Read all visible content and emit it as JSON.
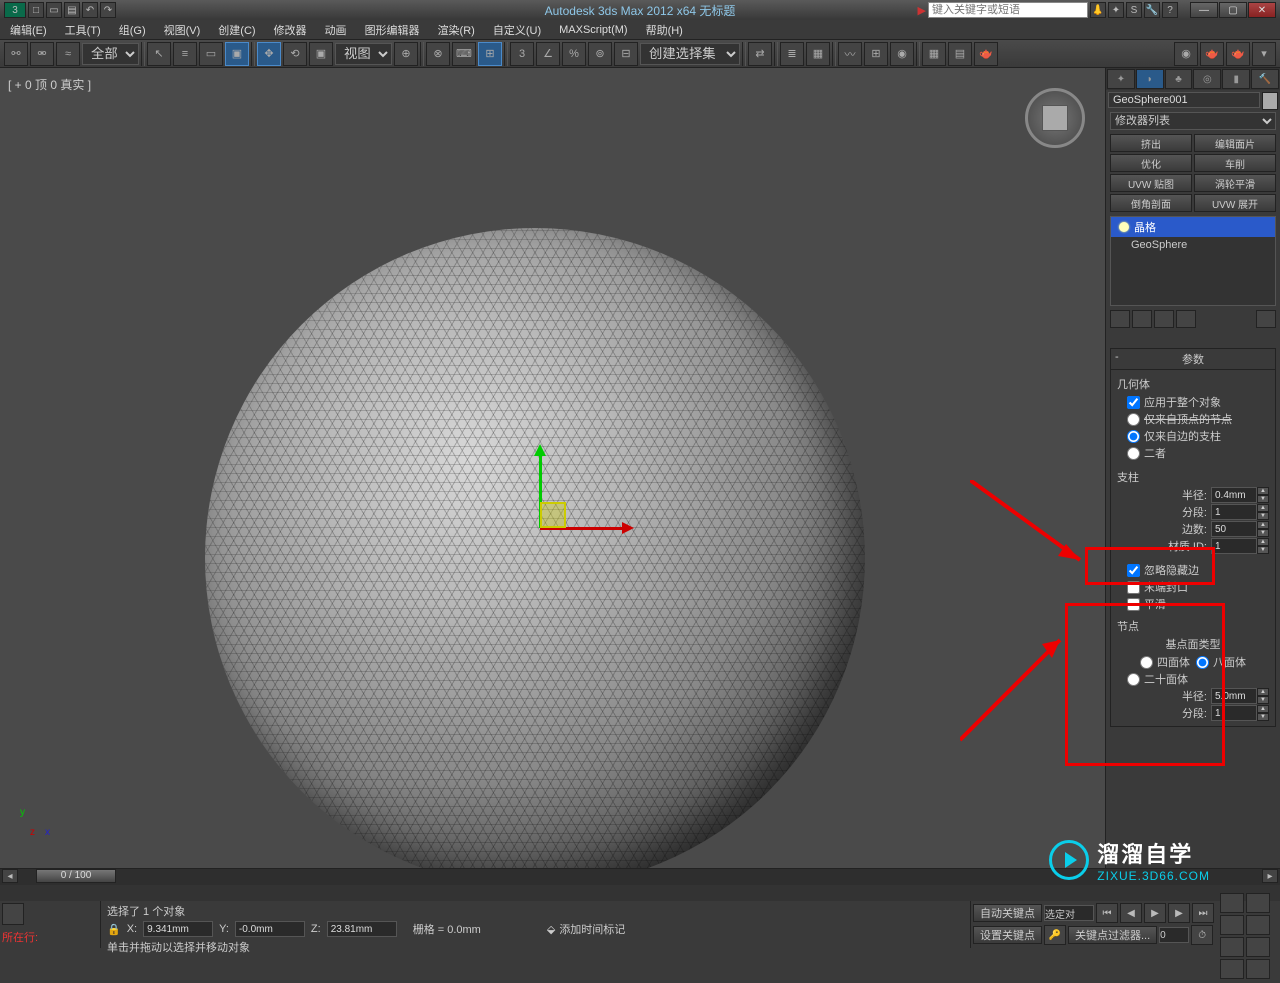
{
  "title": "Autodesk 3ds Max 2012 x64     无标题",
  "search_placeholder": "键入关键字或短语",
  "menu": [
    "编辑(E)",
    "工具(T)",
    "组(G)",
    "视图(V)",
    "创建(C)",
    "修改器",
    "动画",
    "图形编辑器",
    "渲染(R)",
    "自定义(U)",
    "MAXScript(M)",
    "帮助(H)"
  ],
  "toolbar": {
    "all_dd": "全部",
    "view_dd": "视图",
    "sel_set": "创建选择集"
  },
  "viewport": {
    "label": "[ + 0 顶 0 真实 ]"
  },
  "cmd": {
    "object_name": "GeoSphere001",
    "mod_list_label": "修改器列表",
    "buttons": [
      "挤出",
      "编辑面片",
      "优化",
      "车削",
      "UVW 贴图",
      "涡轮平滑",
      "倒角剖面",
      "UVW 展开"
    ],
    "stack": [
      "晶格",
      "GeoSphere"
    ],
    "rollout_title": "参数",
    "geom_label": "几何体",
    "apply_whole": "应用于整个对象",
    "radio1": "仅来自顶点的节点",
    "radio2": "仅来自边的支柱",
    "radio3": "二者",
    "strut_label": "支柱",
    "radius_label": "半径:",
    "radius_val": "0.4mm",
    "seg_label": "分段:",
    "seg_val": "1",
    "edge_label": "边数:",
    "edge_val": "50",
    "matid_label": "材质 ID:",
    "matid_val": "1",
    "chk_ignore": "忽略隐藏边",
    "chk_endcap": "末端封口",
    "chk_smooth": "平滑",
    "node_label": "节点",
    "base_type_label": "基点面类型",
    "radio_quad": "四面体",
    "radio_oct": "八面体",
    "radio_icosa": "二十面体",
    "radius2_label": "半径:",
    "radius2_val": "5.0mm",
    "seg2_label": "分段:",
    "seg2_val": "1"
  },
  "time": {
    "slider": "0 / 100"
  },
  "status": {
    "sel": "选择了 1 个对象",
    "hint": "单击并拖动以选择并移动对象",
    "here": "所在行:",
    "lock_icon": "🔒",
    "x": "9.341mm",
    "y": "-0.0mm",
    "z": "23.81mm",
    "grid": "栅格 = 0.0mm",
    "auto_key": "自动关键点",
    "sel_target": "选定对",
    "set_key": "设置关键点",
    "key_filter": "关键点过滤器...",
    "add_time": "添加时间标记"
  },
  "watermark": {
    "big": "溜溜自学",
    "small": "ZIXUE.3D66.COM"
  }
}
